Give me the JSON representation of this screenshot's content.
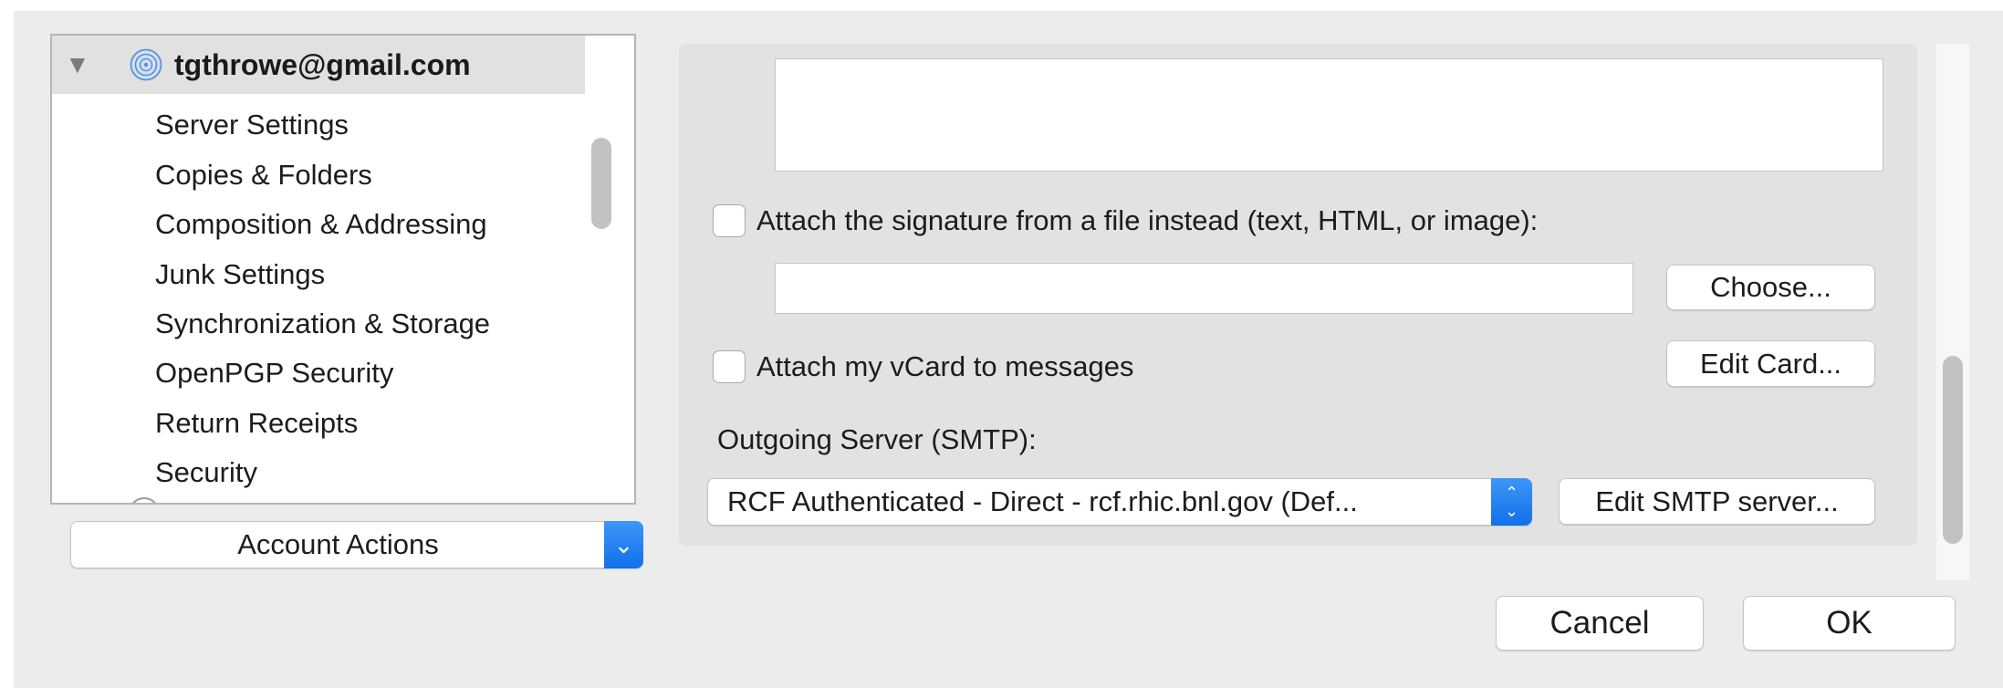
{
  "account": {
    "name": "tgthrowe@gmail.com",
    "disclosure_icon": "triangle-down-icon",
    "icon": "globe-account-icon"
  },
  "tree": {
    "items": [
      {
        "label": "Server Settings"
      },
      {
        "label": "Copies & Folders"
      },
      {
        "label": "Composition & Addressing"
      },
      {
        "label": "Junk Settings"
      },
      {
        "label": "Synchronization & Storage"
      },
      {
        "label": "OpenPGP Security"
      },
      {
        "label": "Return Receipts"
      },
      {
        "label": "Security"
      }
    ]
  },
  "account_actions": {
    "label": "Account Actions",
    "arrow": "⌄"
  },
  "signature": {
    "textarea_value": "",
    "attach_file_label": "Attach the signature from a file instead (text, HTML, or image):",
    "attach_file_checked": false,
    "file_path_value": "",
    "choose_label": "Choose..."
  },
  "vcard": {
    "label": "Attach my vCard to messages",
    "checked": false,
    "edit_label": "Edit Card..."
  },
  "smtp": {
    "label": "Outgoing Server (SMTP):",
    "selected": "RCF Authenticated - Direct - rcf.rhic.bnl.gov (Def...",
    "edit_label": "Edit SMTP server..."
  },
  "dialog": {
    "cancel_label": "Cancel",
    "ok_label": "OK"
  },
  "colors": {
    "accent": "#1c7cf0",
    "panel": "#e2e2e2",
    "window": "#ececec"
  }
}
